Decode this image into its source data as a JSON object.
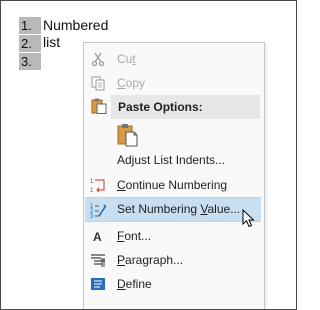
{
  "document": {
    "list": [
      {
        "number": "1.",
        "text": "Numbered list"
      },
      {
        "number": "2.",
        "text": ""
      },
      {
        "number": "3.",
        "text": ""
      }
    ]
  },
  "context_menu": {
    "items": {
      "cut": {
        "pre": "Cu",
        "accel": "t",
        "post": "",
        "icon": "scissors-icon",
        "enabled": false
      },
      "copy": {
        "pre": "",
        "accel": "C",
        "post": "opy",
        "icon": "copy-icon",
        "enabled": false
      },
      "paste_options": {
        "label": "Paste Options:",
        "icon": "clipboard-icon"
      },
      "adjust_indents": {
        "pre": "Adjust List Indents",
        "accel": "",
        "post": "...",
        "icon": ""
      },
      "continue_numbering": {
        "pre": "",
        "accel": "C",
        "post": "ontinue Numbering",
        "icon": "continue-numbering-icon"
      },
      "set_numbering_value": {
        "pre": "Set Numbering ",
        "accel": "V",
        "post": "alue...",
        "icon": "set-numbering-value-icon"
      },
      "font": {
        "pre": "",
        "accel": "F",
        "post": "ont...",
        "icon": "font-icon"
      },
      "paragraph": {
        "pre": "",
        "accel": "P",
        "post": "aragraph...",
        "icon": "paragraph-icon"
      },
      "define": {
        "pre": "",
        "accel": "D",
        "post": "efine",
        "icon": "define-icon"
      }
    }
  },
  "colors": {
    "highlight": "#c8dff2",
    "number_shade": "#b9b9b9",
    "accent_blue": "#2b6cb8",
    "accent_red": "#c0392b"
  }
}
